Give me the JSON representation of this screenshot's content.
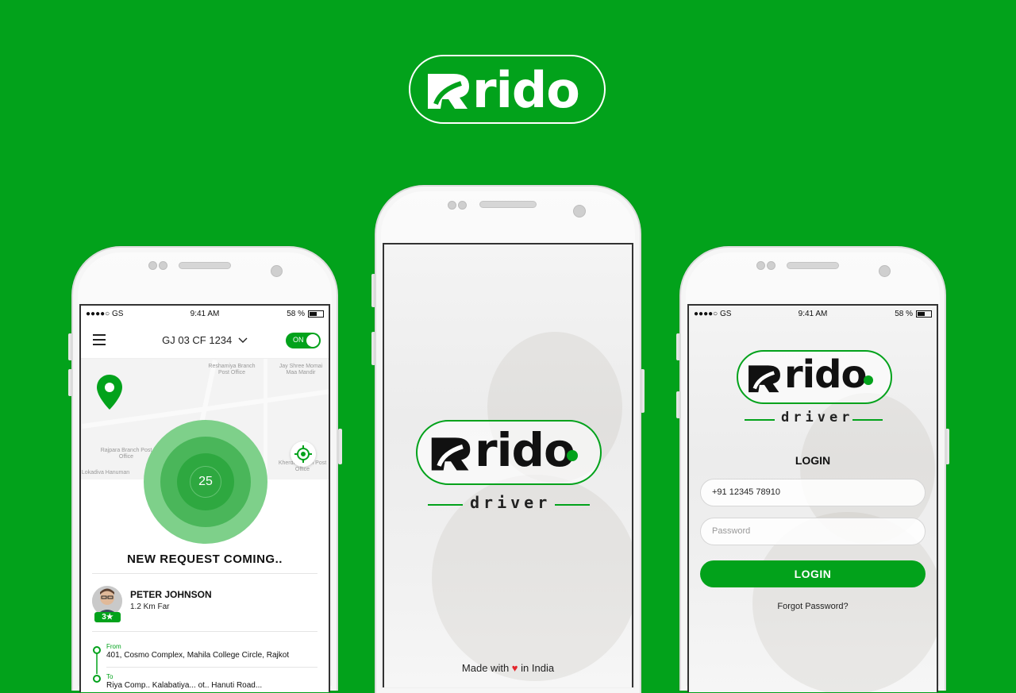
{
  "brand": {
    "logo_word": "rido",
    "sub_word": "driver"
  },
  "status_bar": {
    "carrier": "●●●●○ GS",
    "time": "9:41 AM",
    "battery": "58 %"
  },
  "dashboard": {
    "vehicle_plate": "GJ 03 CF 1234",
    "toggle_label": "ON",
    "map_labels": [
      "Reshamiya Branch Post Office",
      "Jay Shree Momai Maa Mandir",
      "Rajpara Branch Post Office",
      "Kherdi Branch Post Office",
      "Lokadiva Hanuman"
    ],
    "countdown": "25",
    "request_heading": "NEW REQUEST COMING..",
    "rider_name": "PETER JOHNSON",
    "rider_distance": "1.2 Km Far",
    "rider_rating": "3★",
    "from_label": "From",
    "from_address": "401, Cosmo Complex, Mahila College Circle, Rajkot",
    "to_label": "To",
    "to_address": "Riya Comp.. Kalabatiya... ot.. Hanuti Road..."
  },
  "splash": {
    "footer_pre": "Made with",
    "footer_post": "in India",
    "heart_color": "#e4262c"
  },
  "login": {
    "heading": "LOGIN",
    "phone_value": "+91 12345 78910",
    "password_placeholder": "Password",
    "button_label": "LOGIN",
    "forgot_label": "Forgot Password?"
  },
  "colors": {
    "brand_green": "#02a21b",
    "background": "#02a21b"
  }
}
